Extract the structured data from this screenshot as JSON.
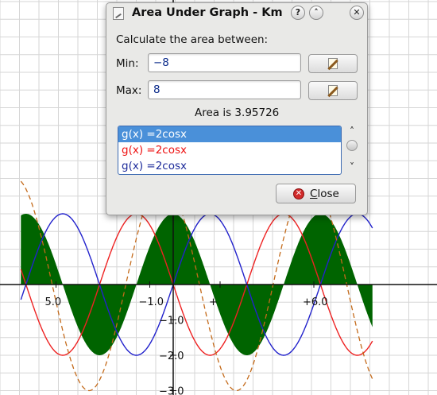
{
  "plot": {
    "colors": {
      "background": "#ffffff",
      "grid": "#d6d6d6",
      "axis": "#111111",
      "area_fill": "#006400",
      "red_curve": "#ee2222",
      "blue_curve": "#2222cc",
      "dashed_curve": "#c46a1a"
    },
    "x_tick_labels": [
      {
        "x": -5,
        "label": "5.0"
      },
      {
        "x": -1,
        "label": "−1.0"
      },
      {
        "x": 2,
        "label": "+"
      },
      {
        "x": 6,
        "label": "+6.0"
      }
    ],
    "y_tick_labels": [
      {
        "y": -1,
        "label": "−1.0"
      },
      {
        "y": -2,
        "label": "−2.0"
      },
      {
        "y": -3,
        "label": "−3.0"
      }
    ]
  },
  "chart_data": {
    "type": "line",
    "xlim": [
      -6.5,
      8.5
    ],
    "ylim": [
      -3.5,
      4.5
    ],
    "grid": true,
    "shaded_area": {
      "function": "2cos(x)",
      "x_min": -8,
      "x_max": 8
    },
    "series": [
      {
        "name": "g(x) =2cosx",
        "function": "2cos(x)",
        "color": "#ee2222",
        "style": "solid"
      },
      {
        "name": "g(x) =2cosx",
        "function": "2cos(x)",
        "color": "#2222cc",
        "style": "solid"
      },
      {
        "name": "",
        "function": "",
        "color": "#c46a1a",
        "style": "dashed"
      }
    ]
  },
  "dialog": {
    "title": "Area Under Graph - KmPlot",
    "help_label": "?",
    "shade_label": "˄",
    "close_x_label": "✕",
    "prompt": "Calculate the area between:",
    "min_label": "Min:",
    "min_value": "−8",
    "max_label": "Max:",
    "max_value": "8",
    "result": "Area is 3.95726",
    "functions": [
      {
        "label": "g(x) =2cosx",
        "color": "#ffffff",
        "selected": true
      },
      {
        "label": "g(x) =2cosx",
        "color": "#ee1111",
        "selected": false
      },
      {
        "label": "g(x) =2cosx",
        "color": "#1c2a9a",
        "selected": false
      }
    ],
    "scroll_up_glyph": "˄",
    "scroll_down_glyph": "˅",
    "close_button_label": "Close",
    "close_icon_glyph": "✕",
    "selected_row_color": "#4a90d9"
  }
}
